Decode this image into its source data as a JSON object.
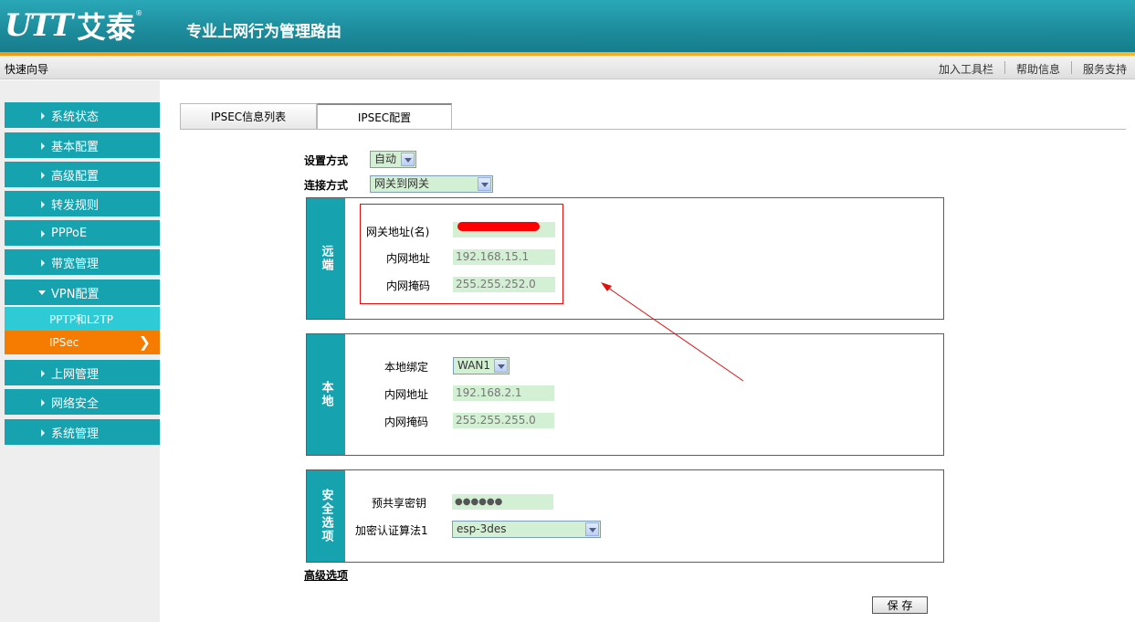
{
  "header": {
    "logo_mark": "UTT",
    "logo_cn": "艾泰",
    "logo_reg": "®",
    "product_title": "专业上网行为管理路由"
  },
  "navbar": {
    "quick_guide": "快速向导",
    "links": [
      "加入工具栏",
      "帮助信息",
      "服务支持"
    ]
  },
  "sidebar": {
    "items": [
      {
        "label": "系统状态"
      },
      {
        "label": "基本配置"
      },
      {
        "label": "高级配置"
      },
      {
        "label": "转发规则"
      },
      {
        "label": "PPPoE"
      },
      {
        "label": "带宽管理"
      },
      {
        "label": "VPN配置",
        "expanded": true
      },
      {
        "label": "上网管理"
      },
      {
        "label": "网络安全"
      },
      {
        "label": "系统管理"
      }
    ],
    "sub_items": [
      {
        "label": "PPTP和L2TP"
      },
      {
        "label": "IPSec",
        "active": true
      }
    ],
    "active_chevron": "❯"
  },
  "tabs": {
    "list": "IPSEC信息列表",
    "config": "IPSEC配置"
  },
  "form": {
    "setup_mode_label": "设置方式",
    "setup_mode_value": "自动",
    "connection_mode_label": "连接方式",
    "connection_mode_value": "网关到网关",
    "remote": {
      "header": "远端",
      "gateway_label": "网关地址(名)",
      "gateway_value": "",
      "lan_addr_label": "内网地址",
      "lan_addr_value": "192.168.15.1",
      "lan_mask_label": "内网掩码",
      "lan_mask_value": "255.255.252.0"
    },
    "local": {
      "header": "本地",
      "bind_label": "本地绑定",
      "bind_value": "WAN1",
      "lan_addr_label": "内网地址",
      "lan_addr_value": "192.168.2.1",
      "lan_mask_label": "内网掩码",
      "lan_mask_value": "255.255.255.0"
    },
    "security": {
      "header": "安全选项",
      "psk_label": "预共享密钥",
      "psk_value": "●●●●●●",
      "algo_label": "加密认证算法1",
      "algo_value": "esp-3des"
    },
    "advanced_label": "高级选项",
    "save_label": "保 存"
  },
  "colors": {
    "teal": "#17a2b0",
    "orange": "#f57c00",
    "input_bg": "#d4f0d4",
    "highlight": "#e01010"
  }
}
